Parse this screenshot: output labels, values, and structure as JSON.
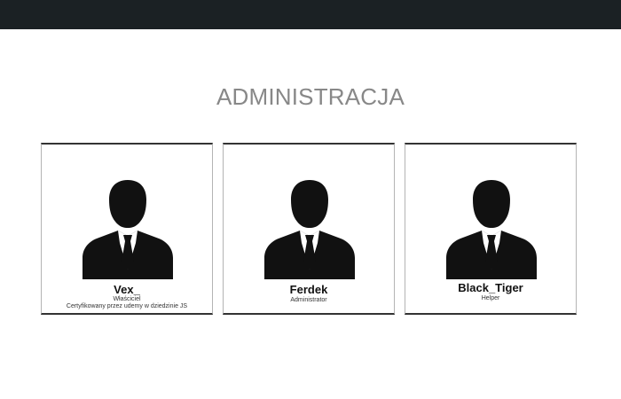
{
  "page": {
    "title": "ADMINISTRACJA"
  },
  "colors": {
    "topbar": "#1b2124",
    "title": "#888888",
    "avatar": "#111111"
  },
  "team": [
    {
      "name": "Vex_",
      "role": "Właściciel",
      "description": "Certyfikowany przez udemy w dziedzinie JS",
      "icon": "user-silhouette-icon"
    },
    {
      "name": "Ferdek",
      "role": "Administrator",
      "icon": "user-silhouette-icon"
    },
    {
      "name": "Black_Tiger",
      "role": "Helper",
      "icon": "user-silhouette-icon"
    }
  ]
}
